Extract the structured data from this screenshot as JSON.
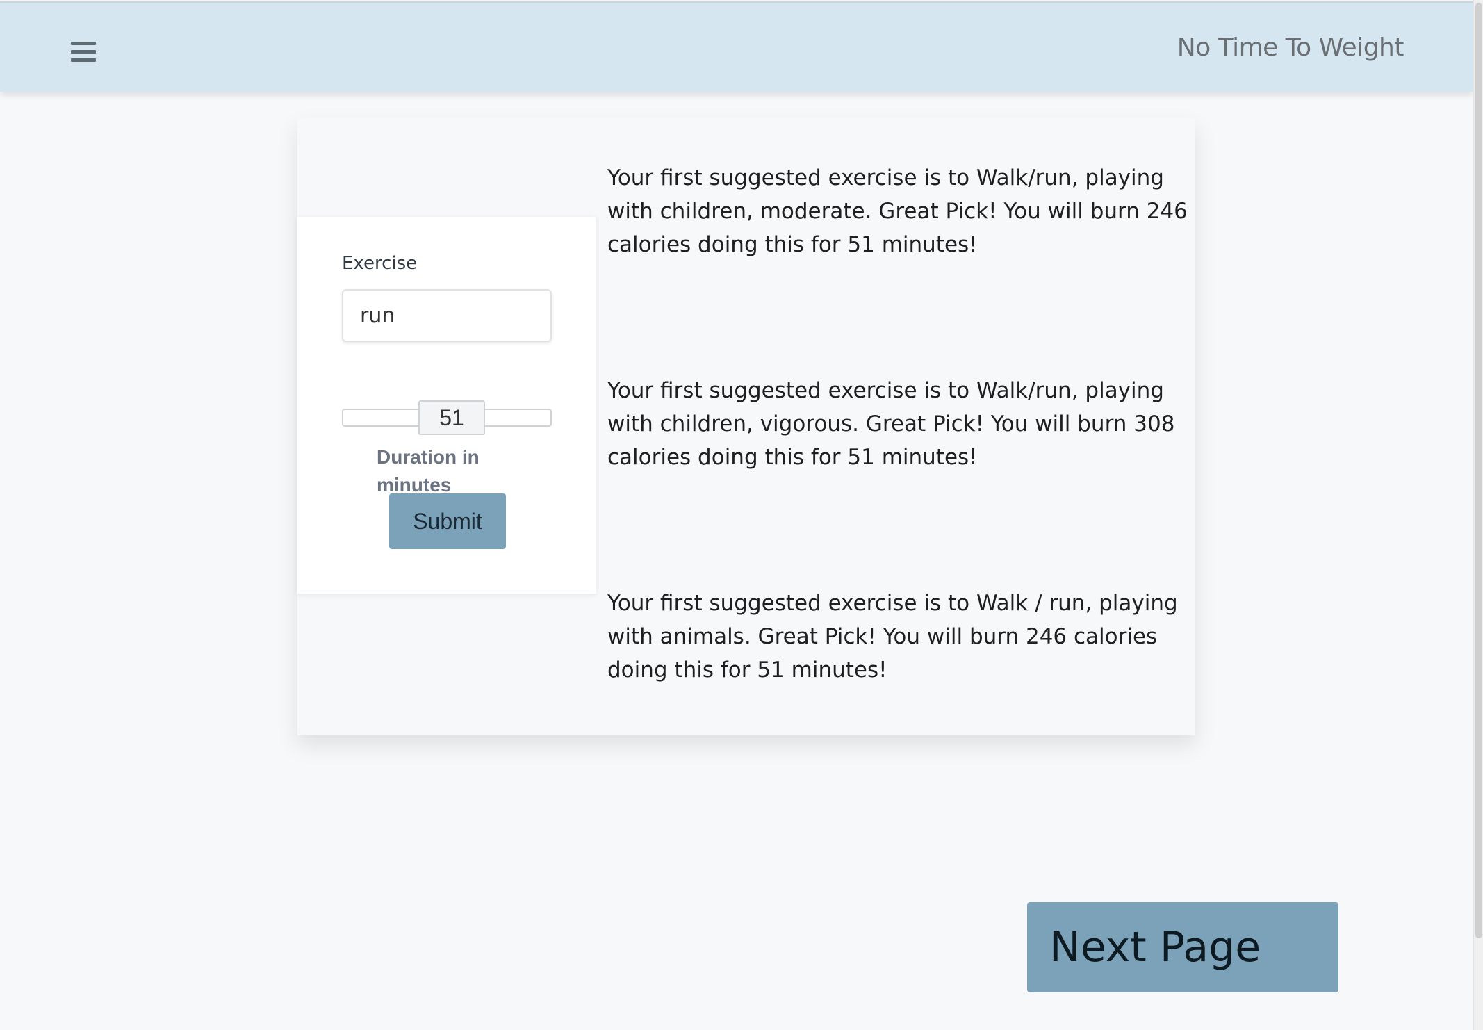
{
  "navbar": {
    "menu_icon": "hamburger-menu-icon",
    "brand": "No Time To Weight"
  },
  "form": {
    "exercise_label": "Exercise",
    "exercise_value": "run",
    "duration_value": "51",
    "duration_label": "Duration in minutes",
    "submit_label": "Submit"
  },
  "suggestions": [
    {
      "text": "Your first suggested exercise is to Walk/run, playing with children, moderate. Great Pick! You will burn 246 calories doing this for 51 minutes!"
    },
    {
      "text": "Your first suggested exercise is to Walk/run, playing with children, vigorous. Great Pick! You will burn 308 calories doing this for 51 minutes!"
    },
    {
      "text": "Your first suggested exercise is to Walk / run, playing with animals. Great Pick! You will burn 246 calories doing this for 51 minutes!"
    }
  ],
  "next_page_label": "Next Page",
  "colors": {
    "navbar_bg": "#d6e6f0",
    "accent_button": "#7ca2ba",
    "page_bg": "#f7f8fa"
  }
}
